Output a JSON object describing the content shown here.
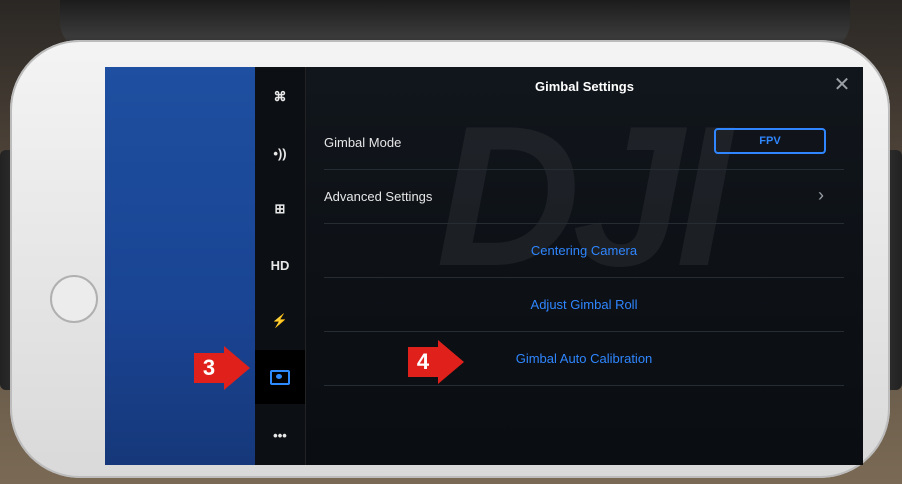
{
  "panel": {
    "title": "Gimbal Settings",
    "close_glyph": "✕",
    "gimbal_mode": {
      "label": "Gimbal Mode",
      "value": "FPV"
    },
    "advanced": {
      "label": "Advanced Settings",
      "chevron": "›"
    },
    "actions": [
      {
        "label": "Centering Camera"
      },
      {
        "label": "Adjust Gimbal Roll"
      },
      {
        "label": "Gimbal Auto Calibration"
      }
    ]
  },
  "sidebar": {
    "items": [
      {
        "icon": "aircraft-icon",
        "glyph": "⌘"
      },
      {
        "icon": "signal-icon",
        "glyph": "•))"
      },
      {
        "icon": "remote-controller-icon",
        "glyph": "⊞"
      },
      {
        "icon": "hd-transmission-icon",
        "glyph": "HD"
      },
      {
        "icon": "battery-icon",
        "glyph": "⚡"
      },
      {
        "icon": "gimbal-camera-icon",
        "glyph": "",
        "active": true
      },
      {
        "icon": "more-icon",
        "glyph": "•••"
      }
    ]
  },
  "annotations": {
    "marker_3": "3",
    "marker_4": "4"
  },
  "watermark": "DJI",
  "colors": {
    "accent": "#2f86ff",
    "marker": "#e0201a",
    "panel_bg": "#0d1116"
  }
}
